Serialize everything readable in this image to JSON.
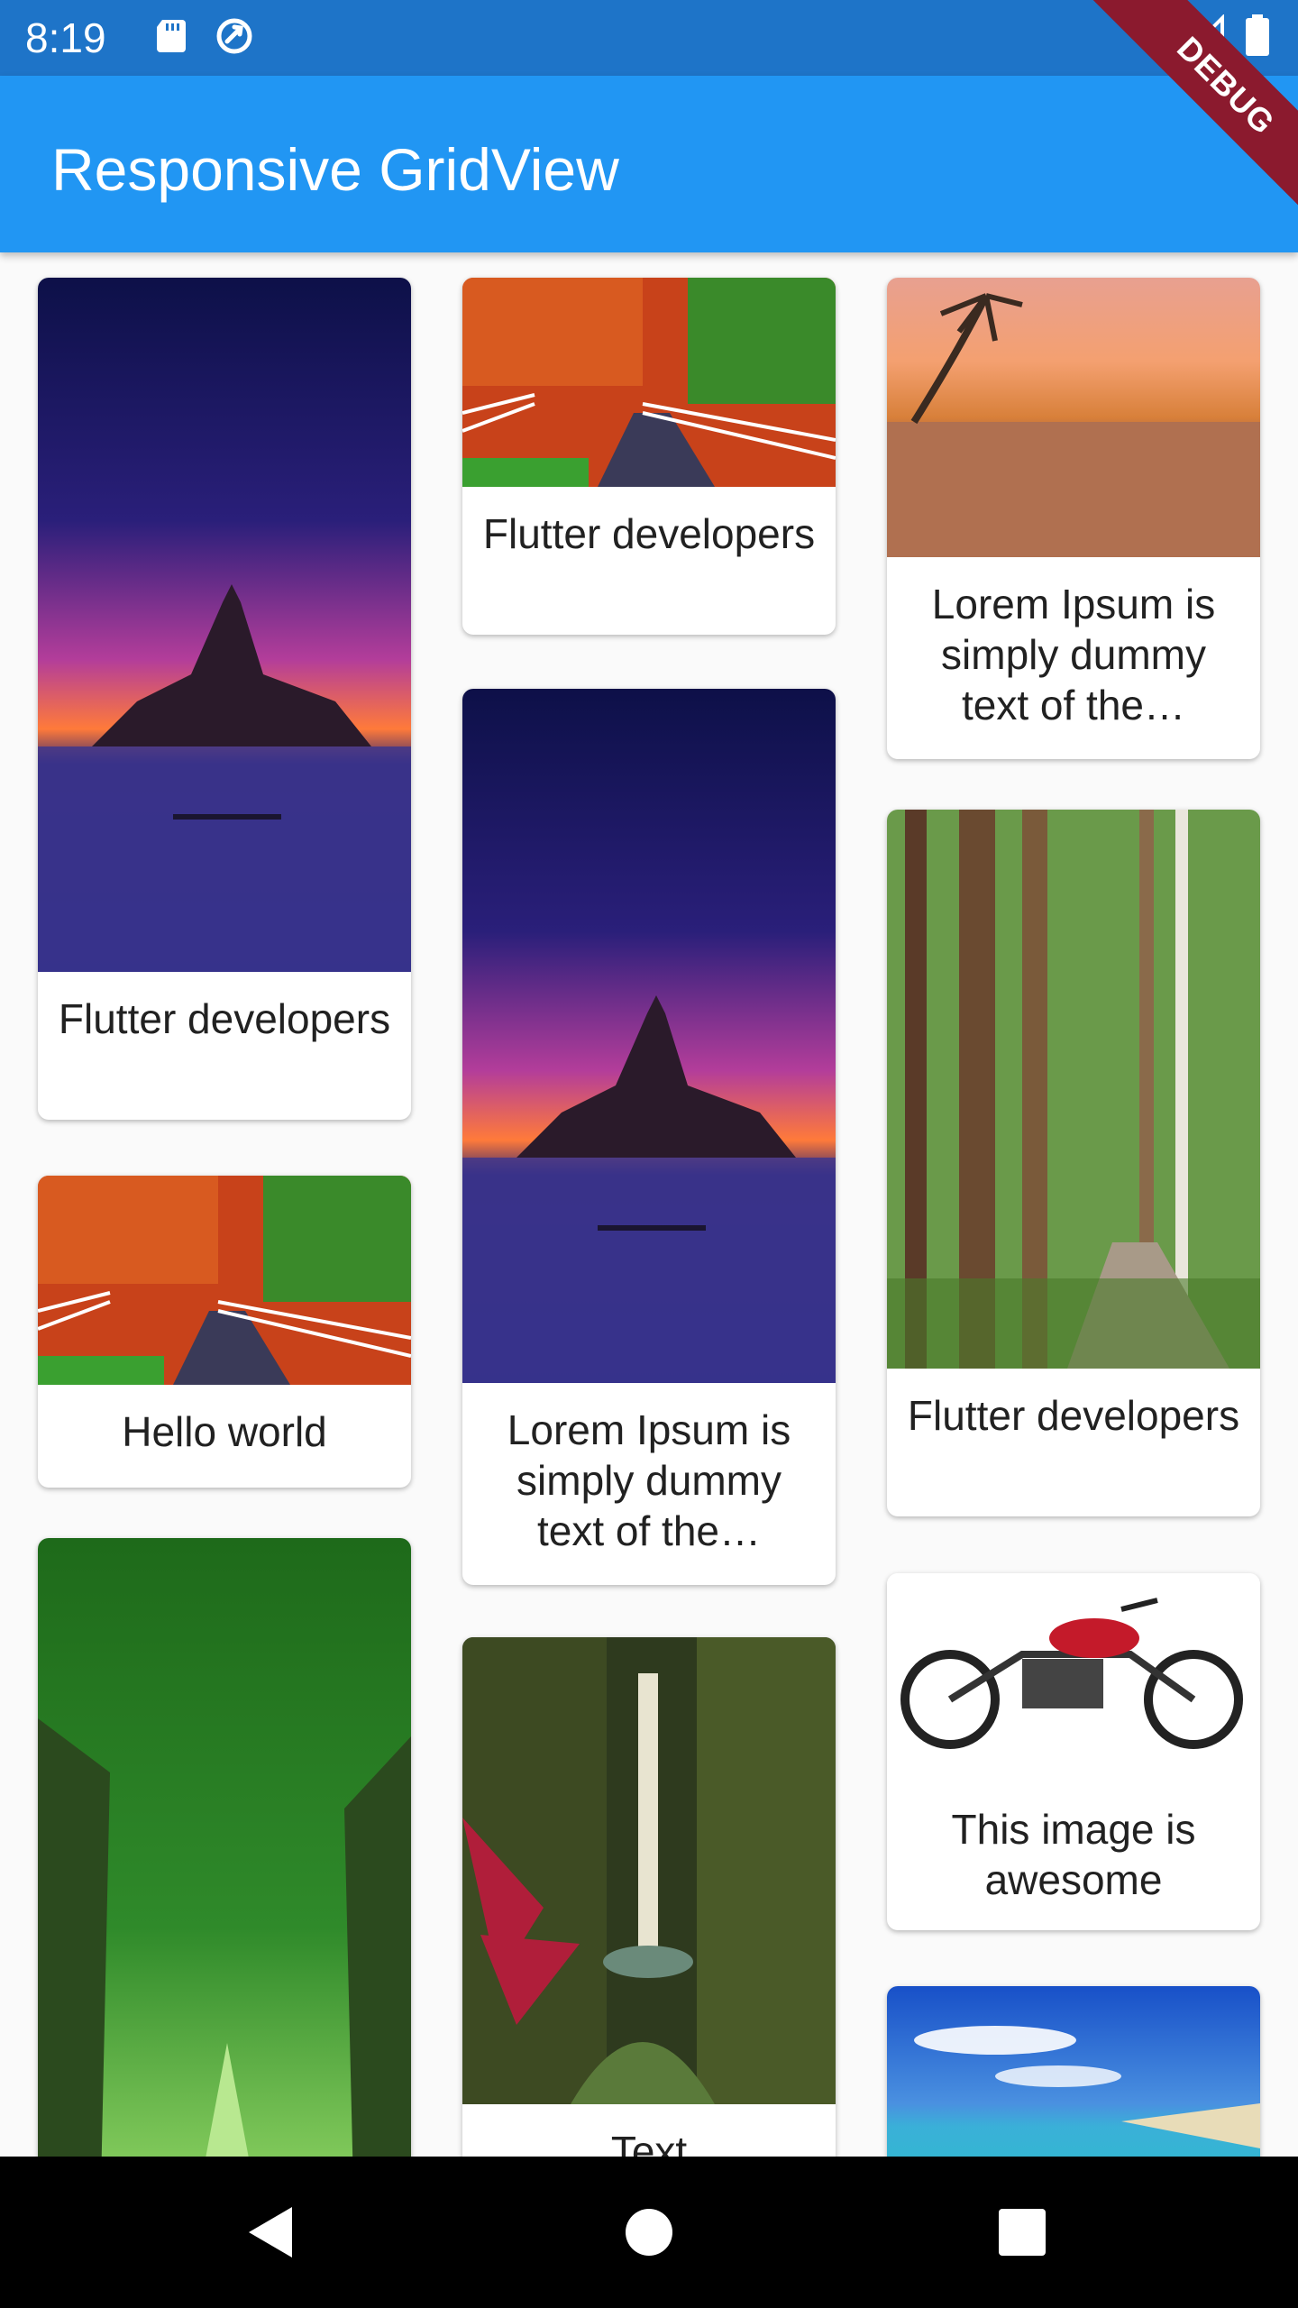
{
  "status_bar": {
    "time": "8:19",
    "icons": [
      "sd-card-icon",
      "sync-icon",
      "wifi-icon",
      "signal-icon",
      "battery-icon"
    ]
  },
  "app_bar": {
    "title": "Responsive GridView",
    "debug_label": "DEBUG"
  },
  "cards": [
    {
      "label": "Flutter developers",
      "image": "island-castle-sunset"
    },
    {
      "label": "Flutter developers",
      "image": "autumn-road-fence"
    },
    {
      "label": "Lorem Ipsum is simply dummy text of the…",
      "image": "beach-palm-sunset"
    },
    {
      "label": "Hello world",
      "image": "autumn-road-fence"
    },
    {
      "label": "Lorem Ipsum is simply dummy text of the…",
      "image": "island-castle-sunset"
    },
    {
      "label": "Flutter developers",
      "image": "forest-path"
    },
    {
      "label": "",
      "image": "green-tree-tunnel"
    },
    {
      "label": "Text",
      "image": "jungle-waterfall"
    },
    {
      "label": "This image is awesome",
      "image": "red-motorcycle"
    },
    {
      "label": "",
      "image": "tropical-beach"
    }
  ],
  "nav_bar": {
    "buttons": [
      "back",
      "home",
      "recents"
    ]
  },
  "colors": {
    "status_bar": "#1e74c8",
    "app_bar": "#2196f3",
    "background": "#fafafa",
    "debug_banner": "#8b1a2e"
  }
}
